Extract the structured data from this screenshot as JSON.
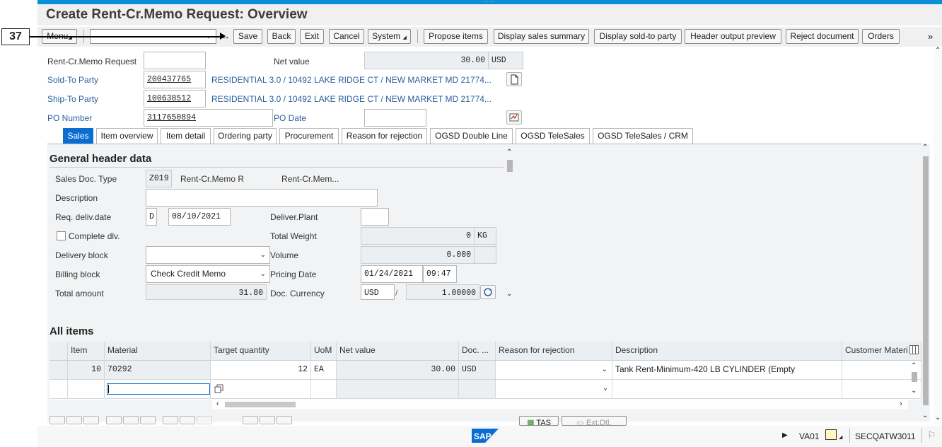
{
  "window": {
    "title": "Create Rent-Cr.Memo Request: Overview"
  },
  "annotation": {
    "step": "37"
  },
  "toolbar": {
    "menu": "Menu",
    "command_field_value": "",
    "save": "Save",
    "back": "Back",
    "exit": "Exit",
    "cancel": "Cancel",
    "system": "System",
    "propose_items": "Propose items",
    "display_sales_summary": "Display sales summary",
    "display_sold_to_party": "Display sold-to party",
    "header_output_preview": "Header output preview",
    "reject_document": "Reject document",
    "orders": "Orders",
    "more": "»"
  },
  "header": {
    "request_label": "Rent-Cr.Memo Request",
    "request_value": "",
    "net_value_label": "Net value",
    "net_value": "30.00",
    "net_currency": "USD",
    "sold_to_label": "Sold-To Party",
    "sold_to_value": "200437765",
    "sold_to_desc": "RESIDENTIAL 3.0 / 10492 LAKE RIDGE CT / NEW MARKET MD 21774...",
    "ship_to_label": "Ship-To Party",
    "ship_to_value": "100638512",
    "ship_to_desc": "RESIDENTIAL 3.0 / 10492 LAKE RIDGE CT / NEW MARKET MD 21774...",
    "po_number_label": "PO Number",
    "po_number_value": "3117650894",
    "po_date_label": "PO Date",
    "po_date_value": ""
  },
  "tabs": [
    "Sales",
    "Item overview",
    "Item detail",
    "Ordering party",
    "Procurement",
    "Reason for rejection",
    "OGSD Double Line",
    "OGSD TeleSales",
    "OGSD TeleSales / CRM"
  ],
  "general": {
    "section_title": "General header data",
    "doc_type_label": "Sales Doc. Type",
    "doc_type_value": "Z019",
    "doc_type_desc1": "Rent-Cr.Memo R",
    "doc_type_desc2": "Rent-Cr.Mem...",
    "description_label": "Description",
    "description_value": "",
    "req_deliv_label": "Req. deliv.date",
    "req_deliv_unit": "D",
    "req_deliv_value": "08/10/2021",
    "deliver_plant_label": "Deliver.Plant",
    "deliver_plant_value": "",
    "complete_dlv_label": "Complete dlv.",
    "total_weight_label": "Total Weight",
    "total_weight_value": "0",
    "total_weight_unit": "KG",
    "delivery_block_label": "Delivery block",
    "delivery_block_value": "",
    "volume_label": "Volume",
    "volume_value": "0.000",
    "billing_block_label": "Billing block",
    "billing_block_value": "Check Credit Memo",
    "pricing_date_label": "Pricing Date",
    "pricing_date_value": "01/24/2021",
    "pricing_time_value": "09:47",
    "total_amount_label": "Total amount",
    "total_amount_value": "31.80",
    "doc_currency_label": "Doc. Currency",
    "doc_currency_value": "USD",
    "exchange_sep": "/",
    "exchange_rate": "1.00000"
  },
  "items": {
    "section_title": "All items",
    "columns": [
      "Item",
      "Material",
      "Target quantity",
      "UoM",
      "Net value",
      "Doc. ...",
      "Reason for rejection",
      "Description",
      "Customer Materi"
    ],
    "rows": [
      {
        "item": "10",
        "material": "70292",
        "qty": "12",
        "uom": "EA",
        "net": "30.00",
        "doc": "USD",
        "reason": "",
        "desc": "Tank Rent-Minimum-420 LB CYLINDER (Empty",
        "cust": ""
      }
    ],
    "bottom_buttons": [
      "TAS",
      "Ext.Dtl."
    ]
  },
  "status": {
    "brand": "SAP",
    "transaction": "VA01",
    "system": "SECQATW3011"
  }
}
